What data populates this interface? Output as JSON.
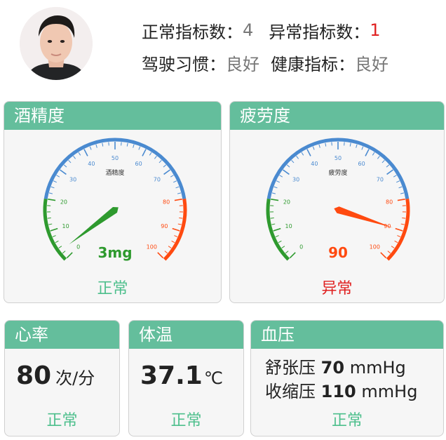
{
  "summary": {
    "normal_count_label": "正常指标数：",
    "normal_count": "4",
    "abnormal_count_label": "异常指标数：",
    "abnormal_count": "1",
    "driving_label": "驾驶习惯：",
    "driving_value": "良好",
    "health_label": "健康指标：",
    "health_value": "良好"
  },
  "alcohol": {
    "title": "酒精度",
    "gauge_label": "酒精度",
    "value": 3,
    "display": "3mg",
    "min": 0,
    "max": 100,
    "status": "正常",
    "value_color": "#2e9a2e"
  },
  "fatigue": {
    "title": "疲劳度",
    "gauge_label": "疲劳度",
    "value": 90,
    "display": "90",
    "min": 0,
    "max": 100,
    "status": "异常",
    "value_color": "#ff4a10"
  },
  "heart": {
    "title": "心率",
    "value": "80",
    "unit": "次/分",
    "status": "正常"
  },
  "temp": {
    "title": "体温",
    "value": "37.1",
    "unit": "℃",
    "status": "正常"
  },
  "bp": {
    "title": "血压",
    "diastolic_label": "舒张压",
    "diastolic_value": "70",
    "diastolic_unit": "mmHg",
    "systolic_label": "收缩压",
    "systolic_value": "110",
    "systolic_unit": "mmHg",
    "status": "正常"
  },
  "gauge_ticks": [
    "0",
    "10",
    "20",
    "30",
    "40",
    "50",
    "60",
    "70",
    "80",
    "90",
    "100"
  ],
  "colors": {
    "header_green": "#64be9c",
    "normal_green": "#4dbf8c",
    "abnormal_red": "#e02020",
    "gauge_green": "#2e9a2e",
    "gauge_blue": "#4a8ad0",
    "gauge_red": "#ff4a10"
  }
}
